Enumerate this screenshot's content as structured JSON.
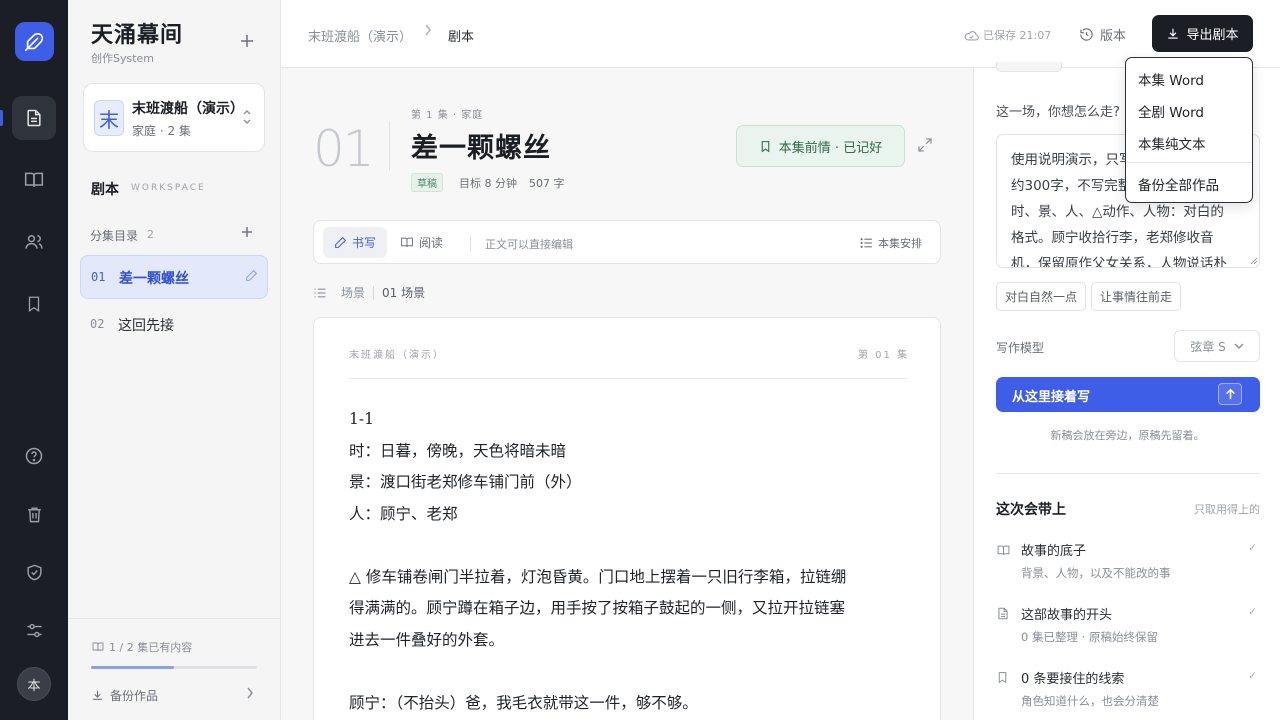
{
  "brand": {
    "title": "天涌幕间",
    "subtitle": "创作System",
    "accent": "#3f5ee8"
  },
  "rail": {
    "avatar": "本"
  },
  "project": {
    "avatar": "末",
    "name": "末班渡船（演示）",
    "meta": "家庭 · 2 集"
  },
  "section": {
    "title": "剧本",
    "sub": "WORKSPACE"
  },
  "episodes": {
    "heading": "分集目录",
    "count": "2",
    "items": [
      {
        "num": "01",
        "title": "差一颗螺丝"
      },
      {
        "num": "02",
        "title": "这回先接"
      }
    ]
  },
  "footer": {
    "progress": "1 / 2 集已有内容",
    "progress_fraction": 0.5,
    "backup": "备份作品"
  },
  "topbar": {
    "crumb_project": "末班渡船（演示）",
    "crumb_page": "剧本",
    "saved": "已保存 21:07",
    "version": "版本",
    "export": "导出剧本"
  },
  "export_menu": [
    "本集 Word",
    "全剧 Word",
    "本集纯文本",
    "备份全部作品"
  ],
  "episode": {
    "big_num": "01",
    "meta": "第 1 集 · 家庭",
    "title": "差一颗螺丝",
    "tag": "草稿",
    "goal": "目标 8 分钟",
    "words": "507 字",
    "recap": "本集前情 · 已记好"
  },
  "toolbar": {
    "write": "书写",
    "read": "阅读",
    "hint": "正文可以直接编辑",
    "arrange": "本集安排"
  },
  "scene_bar": {
    "label": "场景",
    "count": "01 场景"
  },
  "page": {
    "header_left": "末班渡船（演示）",
    "header_right": "第 01 集",
    "lines": [
      "1-1",
      "时：日暮，傍晚，天色将暗未暗",
      "景：渡口街老郑修车铺门前（外）",
      "人：顾宁、老郑",
      "",
      "△ 修车铺卷闸门半拉着，灯泡昏黄。门口地上摆着一只旧行李箱，拉链绷",
      "得满满的。顾宁蹲在箱子边，用手按了按箱子鼓起的一侧，又拉开拉链塞",
      "进去一件叠好的外套。",
      "",
      "顾宁：（不抬头）爸，我毛衣就带这一件，够不够。"
    ]
  },
  "assistant": {
    "question": "这一场，你想怎么走?",
    "prompt_lines": [
      "使用说明演示，只写",
      "约300字，不写完整",
      "时、景、人、△动作、人物：对白的",
      "格式。顾宁收拾行李，老郑修收音",
      "机，保留原作父女关系，人物说话朴"
    ],
    "chips": [
      "对白自然一点",
      "让事情往前走"
    ],
    "model_label": "写作模型",
    "model": "弦章 S",
    "go": "从这里接着写",
    "note": "新稿会放在旁边，原稿先留着。",
    "bring_title": "这次会带上",
    "bring_hint": "只取用得上的",
    "items": [
      {
        "title": "故事的底子",
        "sub": "背景、人物，以及不能改的事"
      },
      {
        "title": "这部故事的开头",
        "sub": "0 集已整理 · 原稿始终保留"
      },
      {
        "title": "0 条要接住的线索",
        "sub": "角色知道什么，也会分清楚"
      }
    ]
  }
}
